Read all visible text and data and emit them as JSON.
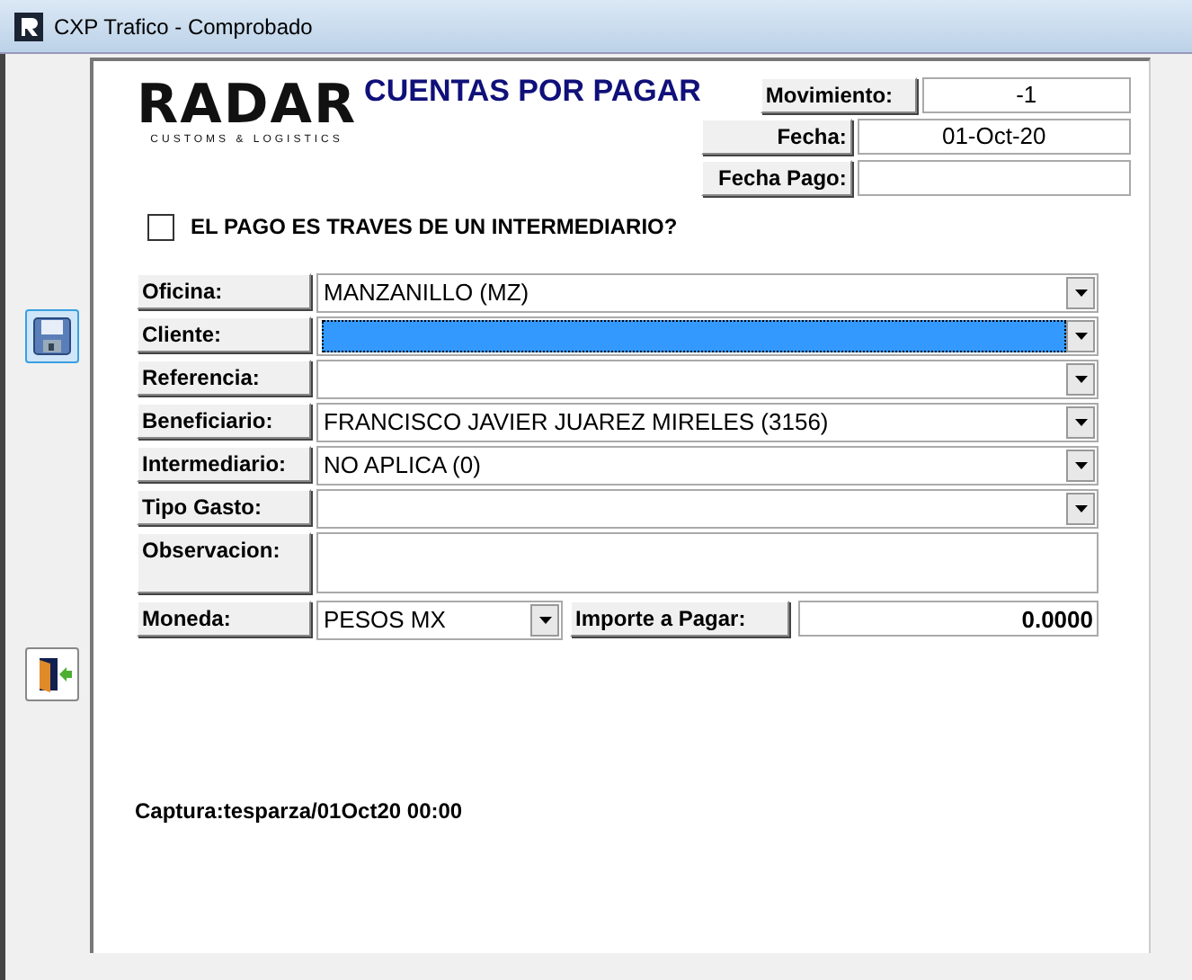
{
  "window": {
    "title": "CXP Trafico - Comprobado"
  },
  "logo": {
    "name": "RADAR",
    "tagline": "CUSTOMS & LOGISTICS"
  },
  "heading": "CUENTAS POR PAGAR",
  "header_fields": [
    {
      "label": "Movimiento:",
      "value": "-1"
    },
    {
      "label": "Fecha:",
      "value": "01-Oct-20"
    },
    {
      "label": "Fecha Pago:"
    }
  ],
  "intermediary_check": {
    "label": "EL PAGO ES TRAVES DE UN INTERMEDIARIO?",
    "checked": false
  },
  "fields": [
    {
      "label": "Oficina:",
      "kind": "combo",
      "value": "MANZANILLO (MZ)",
      "selected": false
    },
    {
      "label": "Cliente:",
      "kind": "combo",
      "selected": true
    },
    {
      "label": "Referencia:",
      "kind": "combo",
      "selected": false
    },
    {
      "label": "Beneficiario:",
      "kind": "combo",
      "value": "FRANCISCO JAVIER JUAREZ MIRELES (3156)",
      "selected": false
    },
    {
      "label": "Intermediario:",
      "kind": "combo",
      "value": "NO APLICA (0)",
      "selected": false
    },
    {
      "label": "Tipo Gasto:",
      "kind": "combo",
      "selected": false
    },
    {
      "label": "Observacion:",
      "kind": "memo",
      "selected": false
    }
  ],
  "currency": {
    "label": "Moneda:",
    "value": "PESOS MX"
  },
  "amount": {
    "label": "Importe a Pagar:",
    "value": "0.0000"
  },
  "capture": "Captura:tesparza/01Oct20 00:00"
}
